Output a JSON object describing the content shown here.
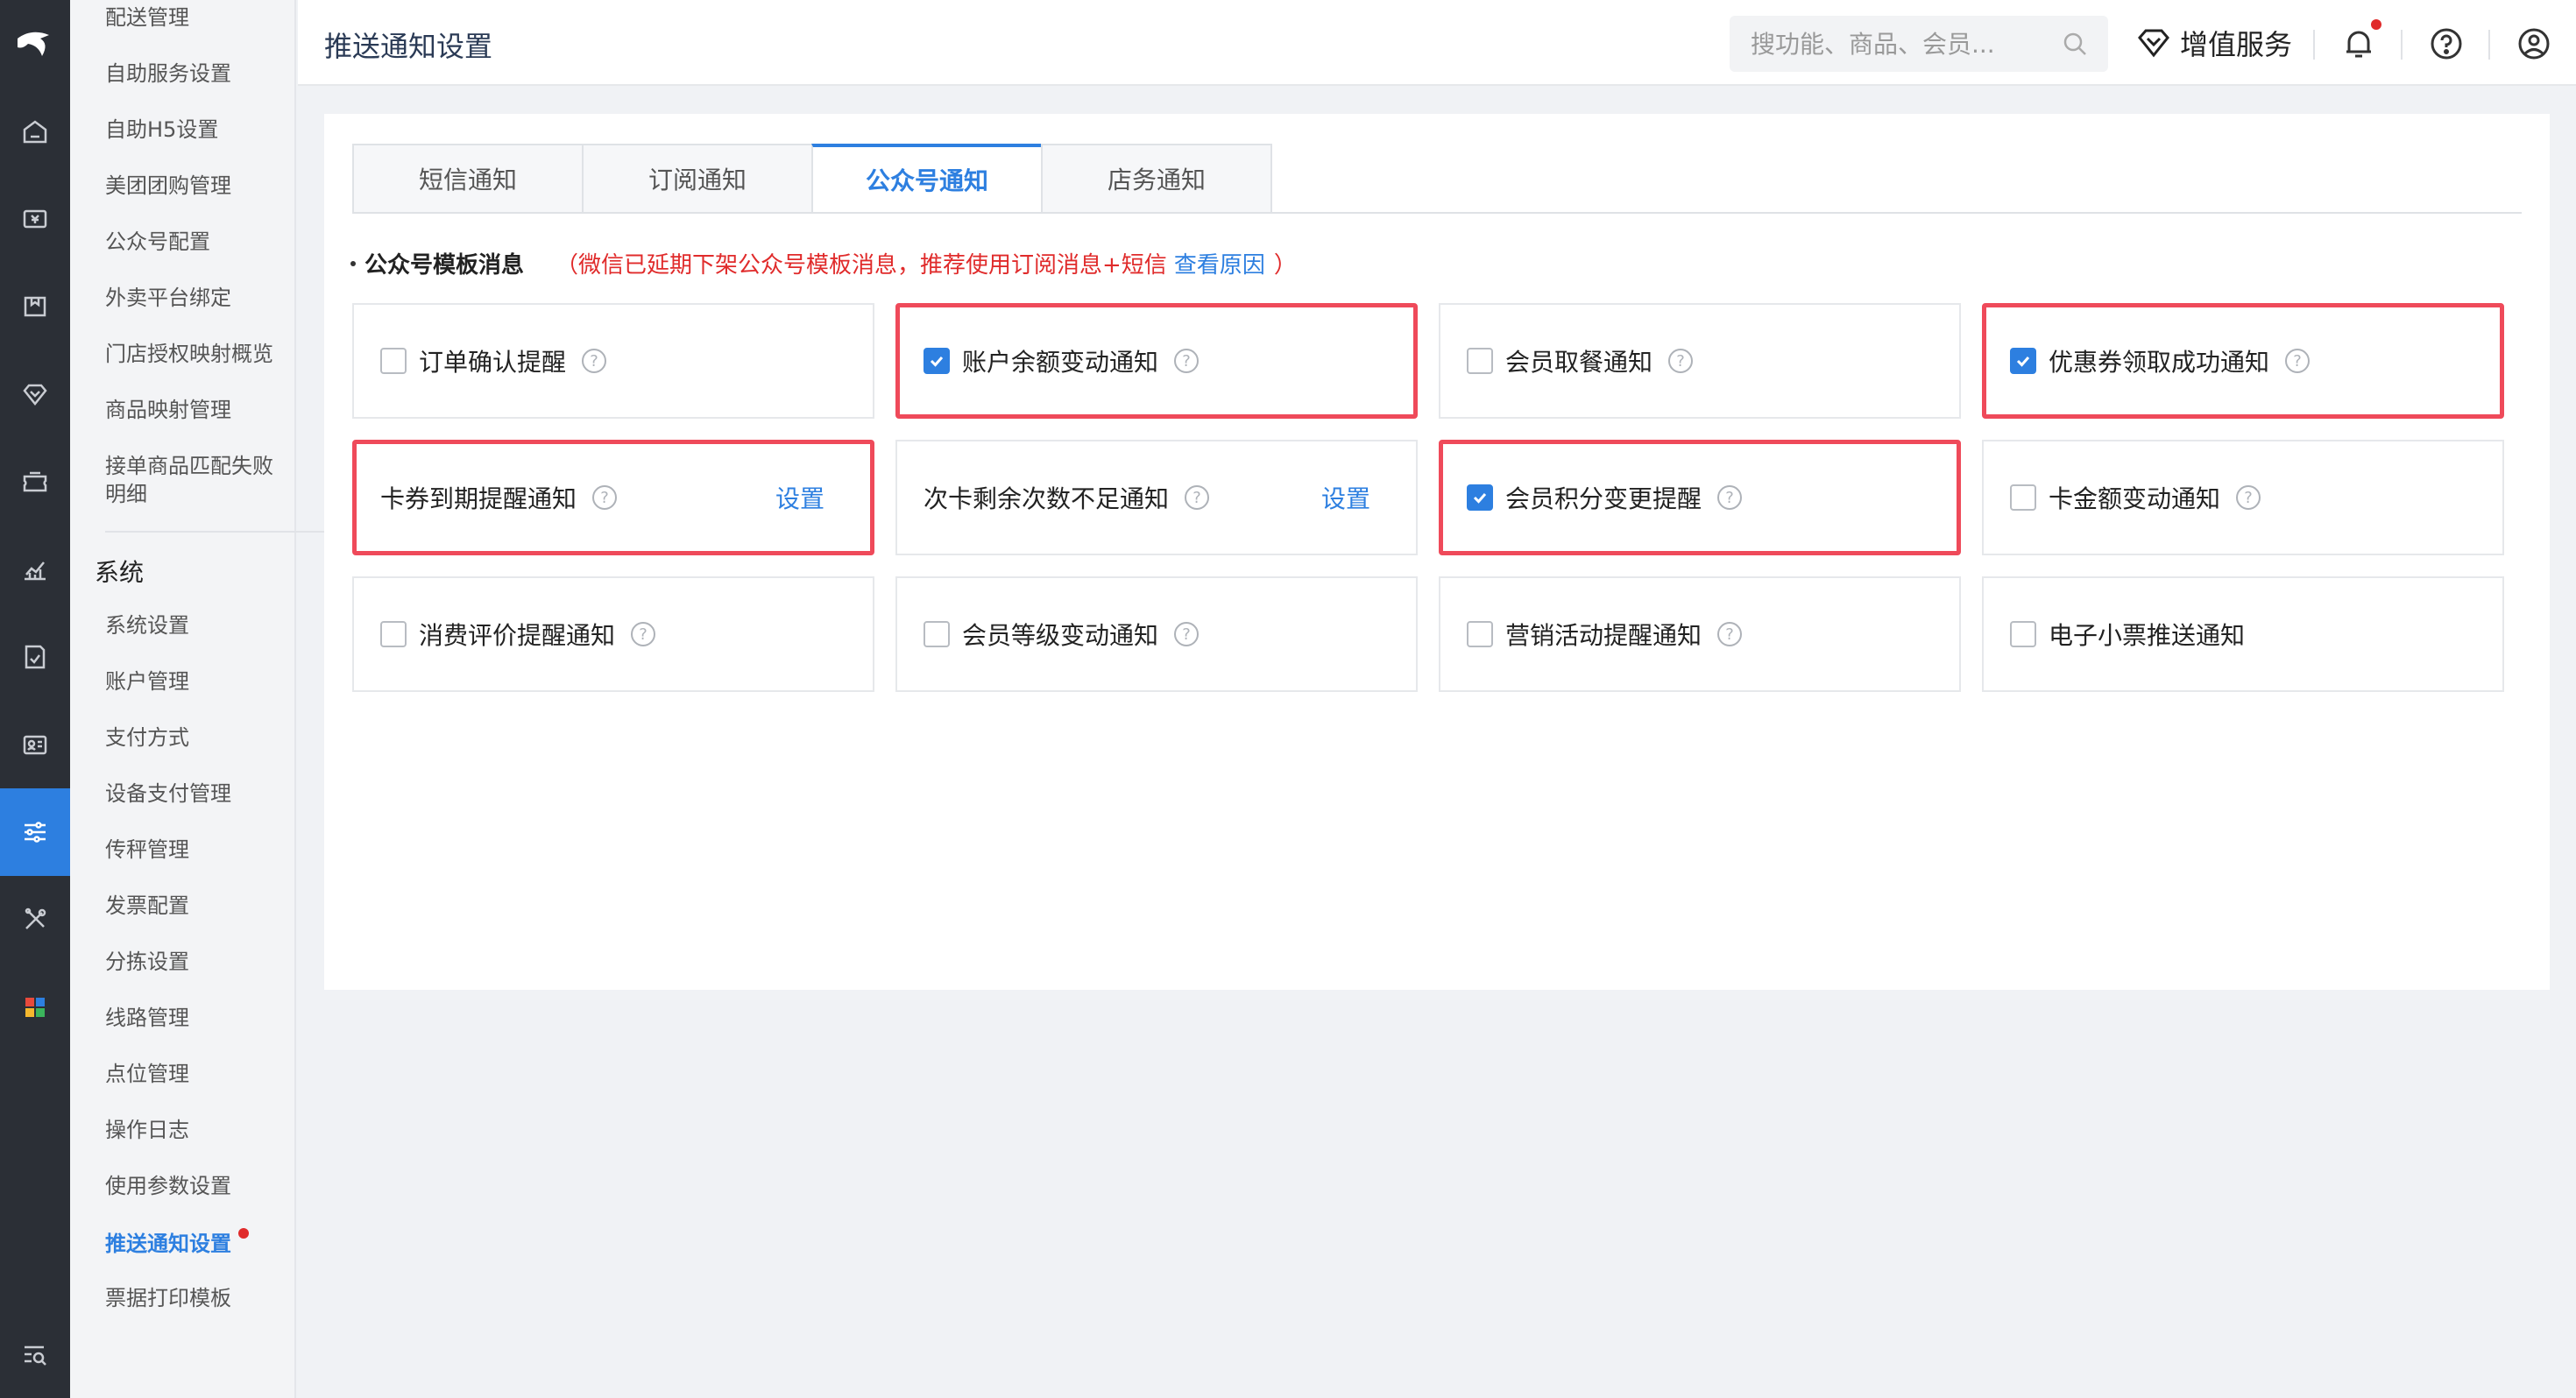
{
  "header": {
    "title": "推送通知设置",
    "search_placeholder": "搜功能、商品、会员...",
    "vip_label": "增值服务"
  },
  "submenu": {
    "items_top": [
      "配送管理",
      "自助服务设置",
      "自助H5设置",
      "美团团购管理",
      "公众号配置",
      "外卖平台绑定",
      "门店授权映射概览",
      "商品映射管理",
      "接单商品匹配失败明细"
    ],
    "group_title": "系统",
    "items_system": [
      "系统设置",
      "账户管理",
      "支付方式",
      "设备支付管理",
      "传秤管理",
      "发票配置",
      "分拣设置",
      "线路管理",
      "点位管理",
      "操作日志",
      "使用参数设置",
      "推送通知设置",
      "票据打印模板"
    ],
    "active": "推送通知设置"
  },
  "tabs": [
    "短信通知",
    "订阅通知",
    "公众号通知",
    "店务通知"
  ],
  "active_tab": 2,
  "section": {
    "title": "公众号模板消息",
    "warning": "（微信已延期下架公众号模板消息，推荐使用订阅消息+短信",
    "link": "查看原因",
    "close": "）"
  },
  "cards": [
    {
      "label": "订单确认提醒",
      "checked": false,
      "checkbox": true,
      "help": true,
      "highlighted": false
    },
    {
      "label": "账户余额变动通知",
      "checked": true,
      "checkbox": true,
      "help": true,
      "highlighted": true
    },
    {
      "label": "会员取餐通知",
      "checked": false,
      "checkbox": true,
      "help": true,
      "highlighted": false
    },
    {
      "label": "优惠券领取成功通知",
      "checked": true,
      "checkbox": true,
      "help": true,
      "highlighted": true
    },
    {
      "label": "卡券到期提醒通知",
      "checked": false,
      "checkbox": false,
      "help": true,
      "highlighted": true,
      "action": "设置"
    },
    {
      "label": "次卡剩余次数不足通知",
      "checked": false,
      "checkbox": false,
      "help": true,
      "highlighted": false,
      "action": "设置"
    },
    {
      "label": "会员积分变更提醒",
      "checked": true,
      "checkbox": true,
      "help": true,
      "highlighted": true
    },
    {
      "label": "卡金额变动通知",
      "checked": false,
      "checkbox": true,
      "help": true,
      "highlighted": false
    },
    {
      "label": "消费评价提醒通知",
      "checked": false,
      "checkbox": true,
      "help": true,
      "highlighted": false
    },
    {
      "label": "会员等级变动通知",
      "checked": false,
      "checkbox": true,
      "help": true,
      "highlighted": false
    },
    {
      "label": "营销活动提醒通知",
      "checked": false,
      "checkbox": true,
      "help": true,
      "highlighted": false
    },
    {
      "label": "电子小票推送通知",
      "checked": false,
      "checkbox": true,
      "help": false,
      "highlighted": false
    }
  ],
  "colors": {
    "accent": "#2d7fe0",
    "highlight": "#ef4a5a",
    "warning": "#e02b2b",
    "rail": "#2b2f36"
  }
}
